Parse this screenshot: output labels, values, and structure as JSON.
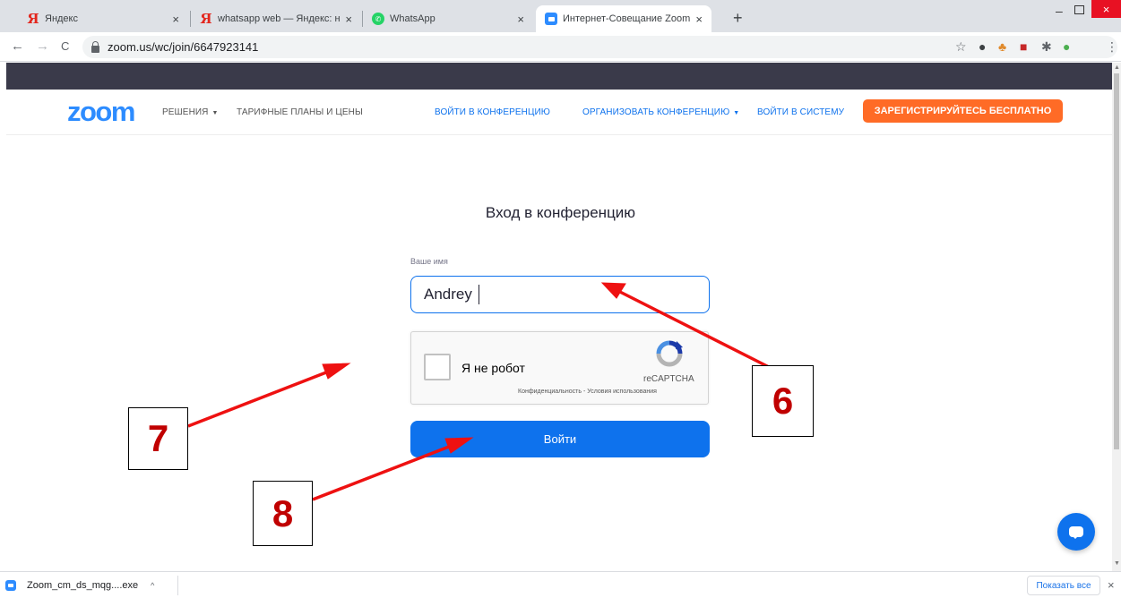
{
  "browser": {
    "tabs": [
      {
        "title": "Яндекс",
        "favicon": "yandex-icon",
        "favicon_glyph": "Я"
      },
      {
        "title": "whatsapp web — Яндекс: нашлос",
        "favicon": "yandex-icon",
        "favicon_glyph": "Я"
      },
      {
        "title": "WhatsApp",
        "favicon": "whatsapp-icon",
        "favicon_glyph": "✆"
      },
      {
        "title": "Интернет-Совещание Zoom - Z",
        "favicon": "zoom-icon",
        "active": true
      }
    ],
    "tab_close_glyph": "×",
    "new_tab_glyph": "+",
    "url": "zoom.us/wc/join/6647923141",
    "nav_glyphs": {
      "back": "←",
      "forward": "→",
      "reload": "C"
    },
    "window_glyphs": {
      "minimize": "–",
      "close": "×"
    },
    "toolbar_glyphs": {
      "bookmark": "☆",
      "ext1": "●",
      "ext2": "♣",
      "ext3": "■",
      "puzzle": "✱",
      "ext4": "●",
      "menu": "⋮"
    }
  },
  "zoom_nav": {
    "logo": "zoom",
    "solutions": "РЕШЕНИЯ",
    "plans": "ТАРИФНЫЕ ПЛАНЫ И ЦЕНЫ",
    "join": "ВОЙТИ В КОНФЕРЕНЦИЮ",
    "host": "ОРГАНИЗОВАТЬ КОНФЕРЕНЦИЮ",
    "signin": "ВОЙТИ В СИСТЕМУ",
    "signup": "ЗАРЕГИСТРИРУЙТЕСЬ БЕСПЛАТНО",
    "caret_glyph": "▼"
  },
  "join_form": {
    "title": "Вход в конференцию",
    "name_label": "Ваше имя",
    "name_value": "Andrey",
    "captcha_label": "Я не робот",
    "captcha_brand": "reCAPTCHA",
    "captcha_links": "Конфиденциальность - Условия использования",
    "submit": "Войти"
  },
  "annotations": [
    {
      "number": "6",
      "target": "name-input"
    },
    {
      "number": "7",
      "target": "recaptcha"
    },
    {
      "number": "8",
      "target": "join-button"
    }
  ],
  "annotation_color": "#ee1111",
  "downloads": {
    "file": "Zoom_cm_ds_mqg....exe",
    "chevron": "^",
    "show_all": "Показать все",
    "close": "×"
  },
  "colors": {
    "zoom_blue": "#0e72ed",
    "signup_orange": "#ff6b26",
    "header_dark": "#3a3a4a"
  }
}
